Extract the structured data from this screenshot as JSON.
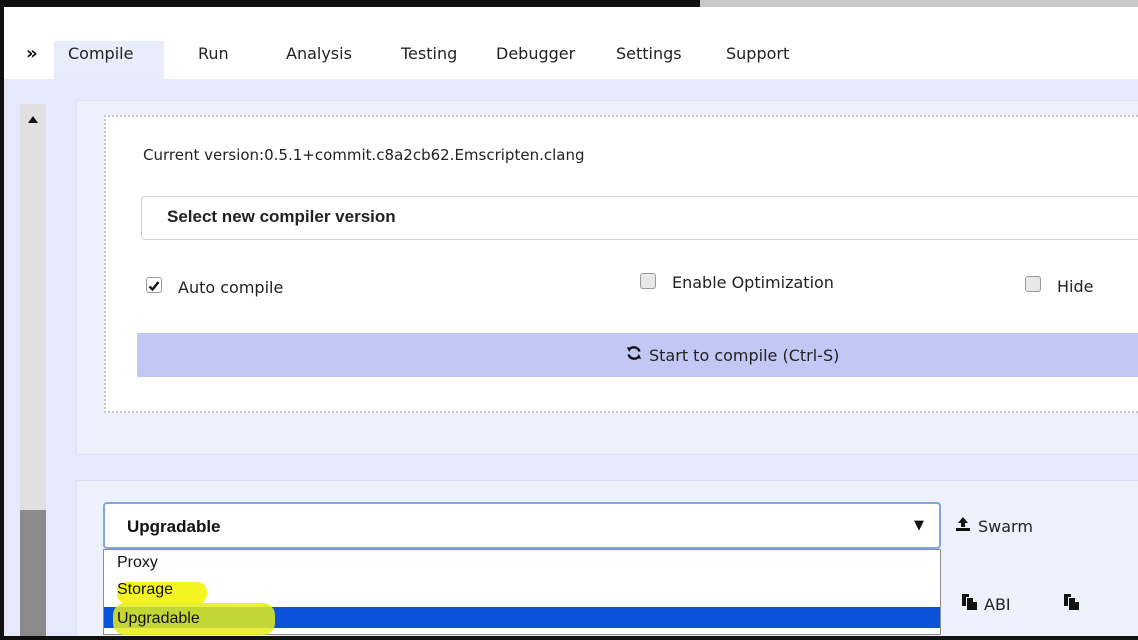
{
  "tabs": [
    {
      "label": "Compile"
    },
    {
      "label": "Run"
    },
    {
      "label": "Analysis"
    },
    {
      "label": "Testing"
    },
    {
      "label": "Debugger"
    },
    {
      "label": "Settings"
    },
    {
      "label": "Support"
    }
  ],
  "active_tab": "Compile",
  "icons": {
    "collapse": "double-chevron-right-icon",
    "compile": "refresh-icon",
    "swarm": "upload-icon",
    "abi": "copy-icon",
    "bytecode": "copy-icon"
  },
  "compiler": {
    "current_version": "Current version:0.5.1+commit.c8a2cb62.Emscripten.clang",
    "select_label": "Select new compiler version",
    "auto_compile_label": "Auto compile",
    "auto_compile_checked": true,
    "optimization_label": "Enable Optimization",
    "optimization_checked": false,
    "hide_label": "Hide",
    "hide_checked": false,
    "compile_button": "Start to compile (Ctrl-S)"
  },
  "contract": {
    "selected": "Upgradable",
    "options": [
      "Proxy",
      "Storage",
      "Upgradable"
    ],
    "highlighted_option": "Upgradable",
    "swarm_label": "Swarm",
    "abi_label": "ABI"
  },
  "colors": {
    "tab_active_bg": "#e9ecfa",
    "panel_bg": "#eef0fc",
    "compile_button_bg": "#c2c8f4",
    "selected_option_bg": "#0a53d8",
    "marker_highlight": "#e5ec1a"
  }
}
